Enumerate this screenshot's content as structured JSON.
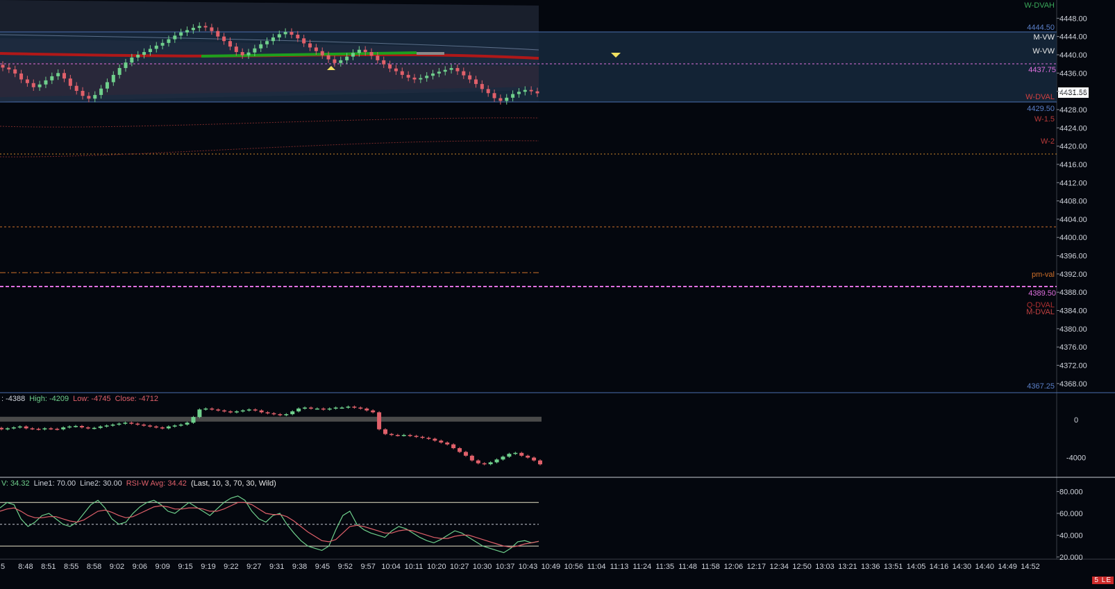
{
  "price_axis": {
    "ticks": [
      "4448.00",
      "4444.00",
      "4440.00",
      "4436.00",
      "4432.00",
      "4428.00",
      "4424.00",
      "4420.00",
      "4416.00",
      "4412.00",
      "4408.00",
      "4404.00",
      "4400.00",
      "4396.00",
      "4392.00",
      "4388.00",
      "4384.00",
      "4380.00",
      "4376.00",
      "4372.00",
      "4368.00"
    ],
    "current_price": "4431.56"
  },
  "level_labels": {
    "w_dvah": "W-DVAH",
    "p4444_50": "4444.50",
    "m_vw": "M-VW",
    "w_vw": "W-VW",
    "p4437_75": "4437.75",
    "w_dval": "W-DVAL",
    "p4429_50": "4429.50",
    "w_1_5": "W-1.5",
    "w_2": "W-2",
    "pm_val": "pm-val",
    "p4389_50": "4389.50",
    "q_dval": "Q-DVAL",
    "m_dval": "M-DVAL",
    "p4367_25": "4367.25"
  },
  "delta_pane": {
    "open": ": -4388",
    "high": "High: -4209",
    "low": "Low: -4745",
    "close": "Close: -4712",
    "ticks": [
      "0",
      "-4000"
    ]
  },
  "rsi_pane": {
    "value": "V: 34.32",
    "line1": "Line1: 70.00",
    "line2": "Line2: 30.00",
    "avg": "RSI-W Avg: 34.42",
    "params": "(Last, 10, 3, 70, 30, Wild)",
    "ticks": [
      "80.000",
      "60.000",
      "40.000",
      "20.000"
    ]
  },
  "time_axis": [
    "5",
    "8:48",
    "8:51",
    "8:55",
    "8:58",
    "9:02",
    "9:06",
    "9:09",
    "9:15",
    "9:19",
    "9:22",
    "9:27",
    "9:31",
    "9:38",
    "9:45",
    "9:52",
    "9:57",
    "10:04",
    "10:11",
    "10:20",
    "10:27",
    "10:30",
    "10:37",
    "10:43",
    "10:49",
    "10:56",
    "11:04",
    "11:13",
    "11:24",
    "11:35",
    "11:48",
    "11:58",
    "12:06",
    "12:17",
    "12:34",
    "12:50",
    "13:03",
    "13:21",
    "13:36",
    "13:51",
    "14:05",
    "14:16",
    "14:30",
    "14:40",
    "14:49",
    "14:52"
  ],
  "status_badge": "5 LE",
  "colors": {
    "background": "#04070e",
    "up": "#6fd08c",
    "down": "#e0606a",
    "value_area": "#16283c",
    "vwap_red": "#b01818",
    "vwap_green": "#1ea01e",
    "pink_line": "#e070e0",
    "orange_line": "#d0702a",
    "blue_label": "#5a7fc8"
  },
  "chart_data": {
    "type": "candlestick",
    "price_close_series": [
      4437.2,
      4436.8,
      4435.9,
      4434.6,
      4433.8,
      4432.9,
      4433.5,
      4434.4,
      4435.3,
      4436.0,
      4434.8,
      4433.2,
      4432.1,
      4431.0,
      4430.4,
      4431.2,
      4432.6,
      4434.0,
      4435.6,
      4437.1,
      4438.3,
      4439.4,
      4440.0,
      4440.6,
      4441.3,
      4442.0,
      4442.6,
      4443.4,
      4444.2,
      4444.9,
      4445.4,
      4445.9,
      4446.3,
      4446.0,
      4445.2,
      4444.0,
      4443.0,
      4441.8,
      4440.6,
      4439.9,
      4440.5,
      4441.4,
      4442.3,
      4443.0,
      4443.8,
      4444.5,
      4445.0,
      4444.4,
      4443.6,
      4442.5,
      4441.6,
      4440.8,
      4439.9,
      4439.0,
      4438.2,
      4438.8,
      4439.6,
      4440.4,
      4441.1,
      4440.6,
      4439.8,
      4438.8,
      4437.9,
      4437.0,
      4436.4,
      4435.6,
      4435.0,
      4434.6,
      4434.9,
      4435.4,
      4435.9,
      4436.3,
      4436.7,
      4437.1,
      4436.4,
      4435.5,
      4434.6,
      4433.6,
      4432.5,
      4431.6,
      4430.5,
      4429.9,
      4430.6,
      4431.4,
      4431.9,
      4432.3,
      4432.0,
      4431.56
    ],
    "delta_close_series": [
      -1000,
      -900,
      -800,
      -700,
      -900,
      -950,
      -1000,
      -900,
      -950,
      -1000,
      -800,
      -700,
      -650,
      -800,
      -900,
      -850,
      -700,
      -600,
      -500,
      -400,
      -300,
      -400,
      -500,
      -600,
      -700,
      -800,
      -900,
      -700,
      -600,
      -500,
      -300,
      300,
      1100,
      1200,
      1100,
      1000,
      900,
      800,
      900,
      1000,
      1100,
      1000,
      800,
      700,
      600,
      500,
      600,
      900,
      1200,
      1300,
      1200,
      1200,
      1100,
      1200,
      1300,
      1300,
      1400,
      1300,
      1200,
      1000,
      800,
      -1000,
      -1500,
      -1600,
      -1650,
      -1600,
      -1700,
      -1800,
      -1900,
      -2000,
      -2200,
      -2400,
      -2600,
      -3000,
      -3400,
      -3800,
      -4300,
      -4600,
      -4700,
      -4500,
      -4200,
      -3900,
      -3600,
      -3500,
      -3800,
      -4000,
      -4300,
      -4712
    ],
    "rsi_series": [
      65,
      70,
      68,
      55,
      48,
      52,
      58,
      60,
      55,
      50,
      48,
      52,
      60,
      68,
      72,
      65,
      55,
      50,
      52,
      60,
      66,
      70,
      72,
      68,
      62,
      60,
      65,
      70,
      66,
      62,
      58,
      64,
      70,
      74,
      76,
      72,
      62,
      55,
      52,
      58,
      60,
      50,
      42,
      35,
      30,
      28,
      26,
      30,
      45,
      58,
      62,
      50,
      45,
      42,
      40,
      38,
      44,
      48,
      46,
      42,
      38,
      35,
      33,
      36,
      40,
      44,
      42,
      38,
      34,
      30,
      28,
      26,
      24,
      28,
      34,
      35,
      33,
      34.32
    ],
    "rsi_avg_series": [
      62,
      64,
      65,
      62,
      58,
      56,
      56,
      57,
      57,
      55,
      53,
      52,
      54,
      58,
      62,
      63,
      61,
      58,
      56,
      57,
      60,
      63,
      66,
      67,
      66,
      64,
      64,
      65,
      65,
      64,
      62,
      62,
      64,
      67,
      70,
      70,
      68,
      64,
      60,
      59,
      59,
      57,
      53,
      48,
      43,
      39,
      35,
      34,
      36,
      42,
      48,
      49,
      48,
      46,
      44,
      42,
      42,
      44,
      45,
      44,
      42,
      40,
      38,
      37,
      37,
      39,
      40,
      40,
      38,
      36,
      34,
      32,
      30,
      29,
      30,
      32,
      33,
      34.42
    ],
    "ylim_price": [
      4366,
      4452
    ],
    "ylim_delta": [
      -5500,
      2000
    ],
    "ylim_rsi": [
      18,
      88
    ],
    "rsi_lines": [
      70,
      50,
      30
    ]
  }
}
